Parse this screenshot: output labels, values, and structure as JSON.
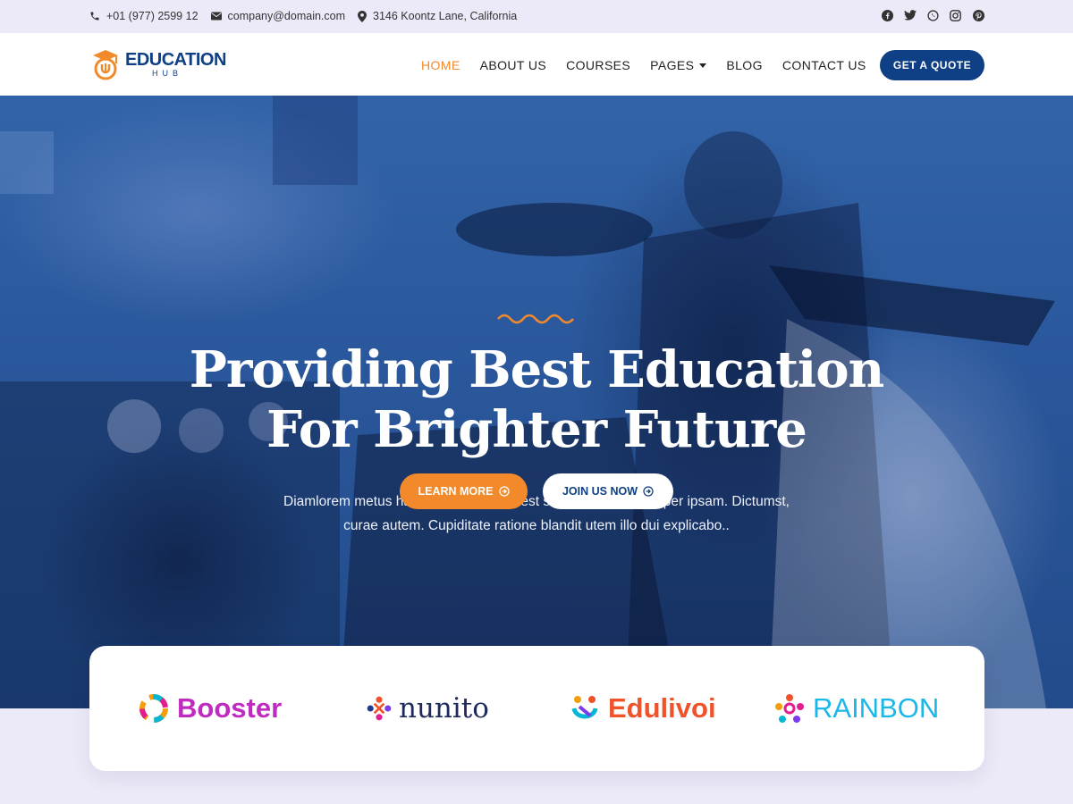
{
  "topbar": {
    "phone": "+01 (977) 2599 12",
    "email": "company@domain.com",
    "address": "3146 Koontz Lane, California",
    "social": [
      "facebook-icon",
      "twitter-icon",
      "whatsapp-icon",
      "instagram-icon",
      "pinterest-icon"
    ]
  },
  "header": {
    "logo_title": "EDUCATION",
    "logo_subtitle": "HUB",
    "nav": [
      {
        "label": "HOME",
        "active": true
      },
      {
        "label": "ABOUT US"
      },
      {
        "label": "COURSES"
      },
      {
        "label": "PAGES",
        "dropdown": true
      },
      {
        "label": "BLOG"
      },
      {
        "label": "CONTACT US"
      }
    ],
    "cta_label": "GET A QUOTE"
  },
  "hero": {
    "title_line1": "Providing Best Education",
    "title_line2": "For Brighter Future",
    "description_line1": "Diamlorem metus habitant voluptatum est sollicitudin conubia per ipsam. Dictumst,",
    "description_line2": "curae autem. Cupiditate ratione blandit utem illo dui explicabo..",
    "primary_button": "LEARN MORE",
    "secondary_button": "JOIN US NOW"
  },
  "brands": [
    {
      "name": "Booster",
      "color": "#c02ac0"
    },
    {
      "name": "nunito",
      "color": "#1e2a5a"
    },
    {
      "name": "Edulivoi",
      "color": "#f0522a"
    },
    {
      "name": "RAINBON",
      "color": "#1ab8e8"
    }
  ],
  "colors": {
    "accent": "#f28a2b",
    "brand": "#0f3f84",
    "topbar_bg": "#eceaf8"
  }
}
